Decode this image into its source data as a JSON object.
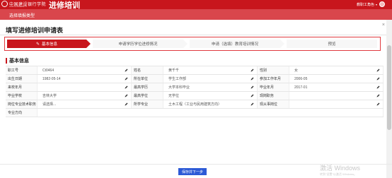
{
  "header": {
    "logo_cn": "中国建设银行学院",
    "logo_en": "CCB UNIVERSITY",
    "app_title": "进修培训",
    "user_role": "教职工角色"
  },
  "subbar": {
    "label": "选择填报类型"
  },
  "modal": {
    "title": "填写进修培训申请表",
    "close": "×"
  },
  "steps": [
    {
      "label": "基本信息",
      "active": true
    },
    {
      "label": "申请学历学位进修情况",
      "active": false
    },
    {
      "label": "申请（选填）教育培训情况",
      "active": false
    },
    {
      "label": "预览",
      "active": false
    }
  ],
  "section": {
    "title": "基本信息"
  },
  "form": {
    "rows": [
      [
        {
          "label": "职工号",
          "value": "Ct0464"
        },
        {
          "label": "姓名",
          "value": "黄千千"
        },
        {
          "label": "性别",
          "value": "女"
        }
      ],
      [
        {
          "label": "出生日期",
          "value": "1982-05-14"
        },
        {
          "label": "所在单位",
          "value": "学生工作部"
        },
        {
          "label": "参加工作年月",
          "value": "2006-05"
        }
      ],
      [
        {
          "label": "来校年月",
          "value": ""
        },
        {
          "label": "最高学历",
          "value": "大学本科毕业"
        },
        {
          "label": "毕业年月",
          "value": "2017-01"
        }
      ],
      [
        {
          "label": "毕业学校",
          "value": "吉林大学"
        },
        {
          "label": "最高学位",
          "value": "无学位"
        },
        {
          "label": "现岗职务",
          "value": ""
        }
      ],
      [
        {
          "label": "岗位专业技术职务",
          "value": "请选择..."
        },
        {
          "label": "所学专业",
          "value": "土木工程（工业与民用建筑方向）"
        },
        {
          "label": "现从事岗位",
          "value": ""
        }
      ]
    ],
    "last_row": {
      "label": "专业方向",
      "value": ""
    }
  },
  "footer": {
    "next_button": "保存并下一步",
    "watermark": "激活 Windows",
    "watermark_sub": "转到\"设置\"以激活 Windows。"
  },
  "colors": {
    "brand_red": "#c8161d",
    "sub_red": "#d9464c",
    "button_blue": "#2d5ad6"
  }
}
